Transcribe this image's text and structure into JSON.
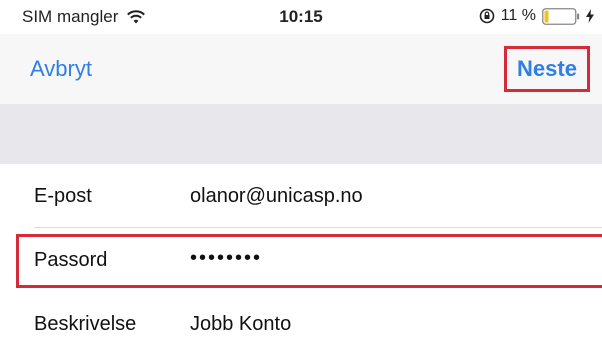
{
  "status_bar": {
    "carrier": "SIM mangler",
    "time": "10:15",
    "battery_percent": "11 %"
  },
  "nav": {
    "cancel_label": "Avbryt",
    "next_label": "Neste"
  },
  "form": {
    "rows": [
      {
        "label": "E-post",
        "value": "olanor@unicasp.no"
      },
      {
        "label": "Passord",
        "value": "••••••••"
      },
      {
        "label": "Beskrivelse",
        "value": "Jobb Konto"
      }
    ]
  },
  "colors": {
    "accent": "#2f7fe6",
    "highlight_border": "#d42a3a",
    "section_band": "#e8e8ec",
    "nav_background": "#f7f7f8"
  },
  "icons": [
    "wifi-icon",
    "rotation-lock-icon",
    "battery-icon",
    "charging-bolt-icon"
  ]
}
